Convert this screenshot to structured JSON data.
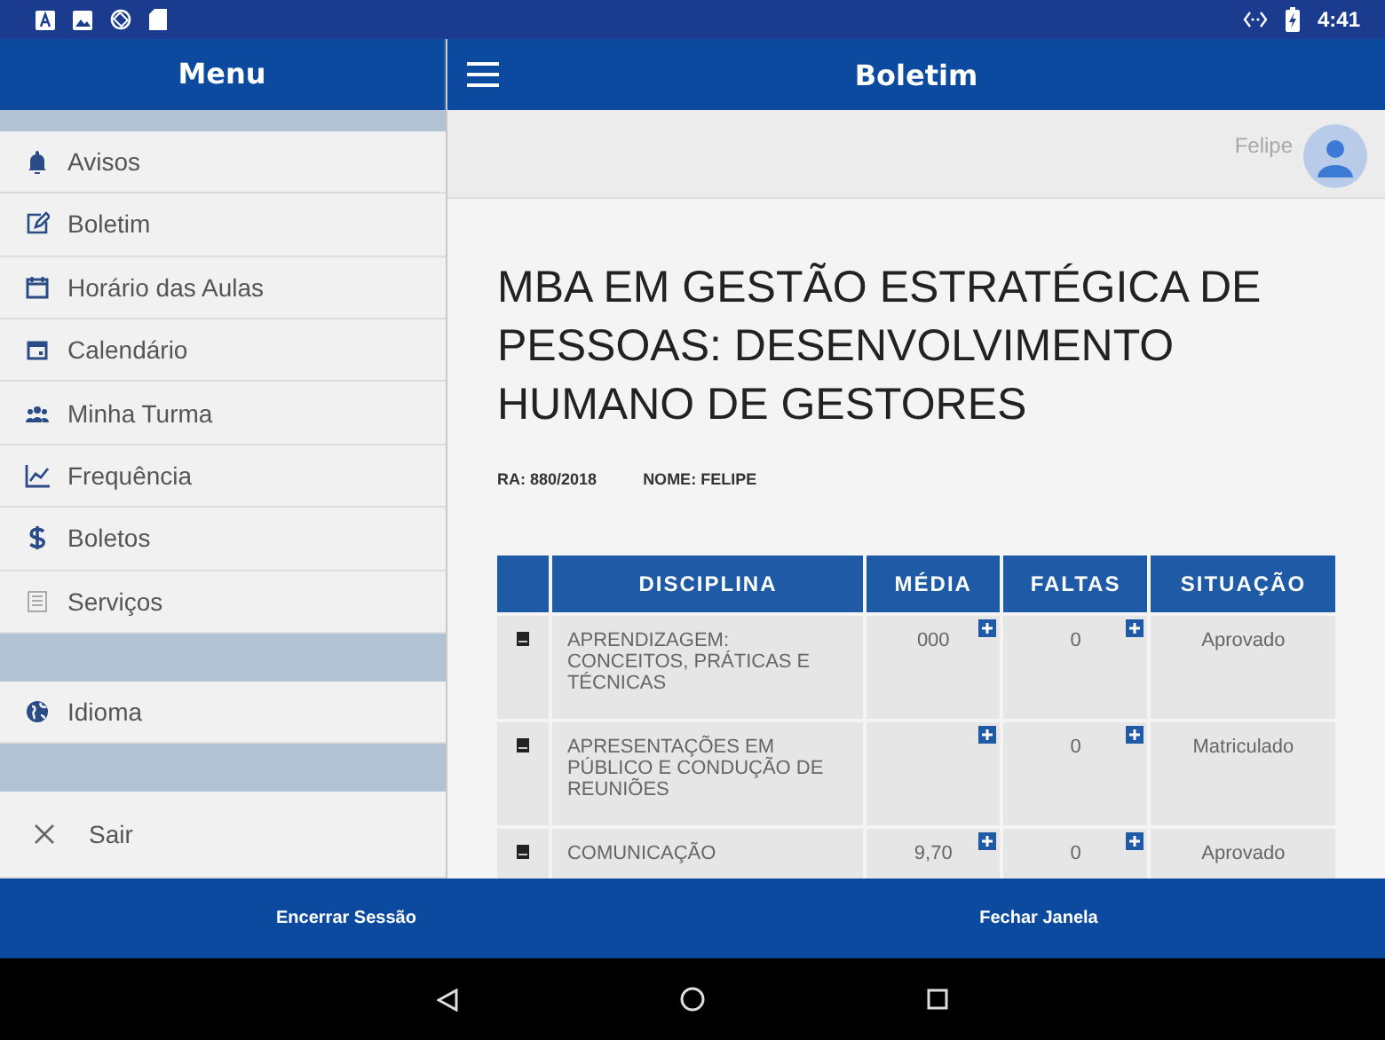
{
  "status_bar": {
    "time": "4:41"
  },
  "sidebar": {
    "title": "Menu",
    "groups": [
      {
        "items": [
          {
            "label": "Avisos"
          },
          {
            "label": "Boletim"
          },
          {
            "label": "Horário das Aulas"
          },
          {
            "label": "Calendário"
          },
          {
            "label": "Minha Turma"
          },
          {
            "label": "Frequência"
          },
          {
            "label": "Boletos"
          },
          {
            "label": "Serviços"
          }
        ]
      },
      {
        "items": [
          {
            "label": "Idioma"
          }
        ]
      },
      {
        "items": [
          {
            "label": "Sair"
          }
        ]
      }
    ]
  },
  "header": {
    "title": "Boletim"
  },
  "profile": {
    "name": "Felipe"
  },
  "course_title": "MBA EM GESTÃO ESTRATÉGICA DE PESSOAS: DESENVOLVIMENTO HUMANO DE GESTORES",
  "student": {
    "ra_label": "RA:",
    "ra": "880/2018",
    "name_label": "NOME:",
    "name": "FELIPE"
  },
  "table": {
    "columns": [
      "DISCIPLINA",
      "MÉDIA",
      "FALTAS",
      "SITUAÇÃO"
    ],
    "rows": [
      {
        "disciplina": "APRENDIZAGEM: CONCEITOS, PRÁTICAS E TÉCNICAS",
        "media": "000",
        "faltas": "0",
        "situacao": "Aprovado"
      },
      {
        "disciplina": "APRESENTAÇÕES EM PÚBLICO E CONDUÇÃO DE REUNIÕES",
        "media": "",
        "faltas": "0",
        "situacao": "Matriculado"
      },
      {
        "disciplina": "COMUNICAÇÃO",
        "media": "9,70",
        "faltas": "0",
        "situacao": "Aprovado"
      }
    ]
  },
  "bottom_bar": {
    "buttons": [
      "Encerrar Sessão",
      "Fechar Janela"
    ]
  }
}
